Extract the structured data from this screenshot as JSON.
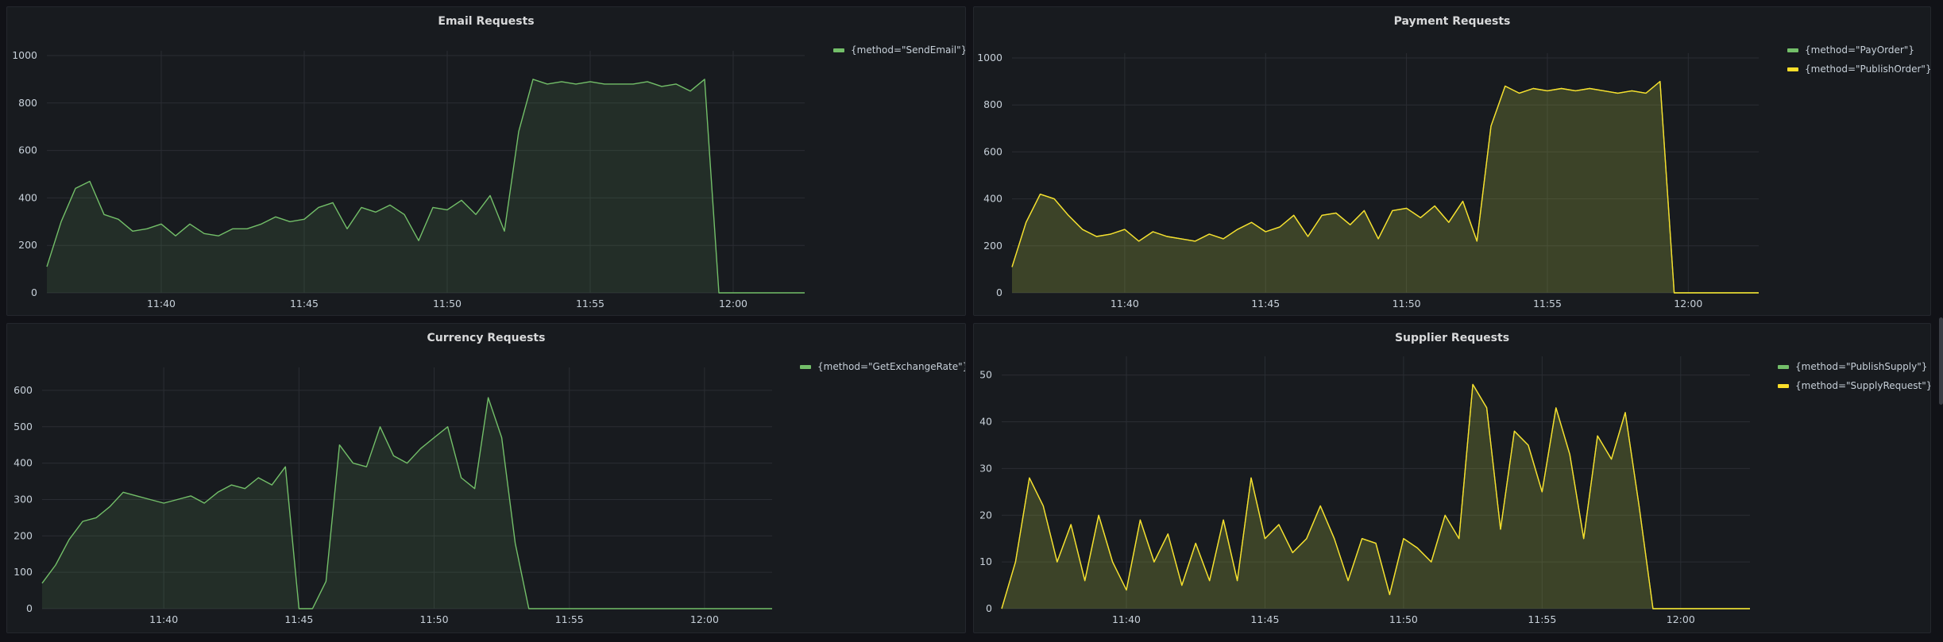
{
  "chart_data": [
    {
      "type": "area",
      "title": "Email Requests",
      "ylim": [
        0,
        1000
      ],
      "yticks": [
        0,
        200,
        400,
        600,
        800,
        1000
      ],
      "xlim": [
        "11:36:00",
        "12:02:30"
      ],
      "xticks": [
        "11:40",
        "11:45",
        "11:50",
        "11:55",
        "12:00"
      ],
      "grid": true,
      "legend_position": "top-right",
      "x": [
        "11:36:00",
        "11:36:30",
        "11:37:00",
        "11:37:30",
        "11:38:00",
        "11:38:30",
        "11:39:00",
        "11:39:30",
        "11:40:00",
        "11:40:30",
        "11:41:00",
        "11:41:30",
        "11:42:00",
        "11:42:30",
        "11:43:00",
        "11:43:30",
        "11:44:00",
        "11:44:30",
        "11:45:00",
        "11:45:30",
        "11:46:00",
        "11:46:30",
        "11:47:00",
        "11:47:30",
        "11:48:00",
        "11:48:30",
        "11:49:00",
        "11:49:30",
        "11:50:00",
        "11:50:30",
        "11:51:00",
        "11:51:30",
        "11:52:00",
        "11:52:30",
        "11:53:00",
        "11:53:30",
        "11:54:00",
        "11:54:30",
        "11:55:00",
        "11:55:30",
        "11:56:00",
        "11:56:30",
        "11:57:00",
        "11:57:30",
        "11:58:00",
        "11:58:30",
        "11:59:00",
        "11:59:30",
        "12:00:00",
        "12:00:30",
        "12:01:00",
        "12:01:30",
        "12:02:00",
        "12:02:30"
      ],
      "series": [
        {
          "name": "{method=\"SendEmail\"}",
          "color": "#73bf69",
          "values": [
            110,
            300,
            440,
            470,
            330,
            310,
            260,
            270,
            290,
            240,
            290,
            250,
            240,
            270,
            270,
            290,
            320,
            300,
            310,
            360,
            380,
            270,
            360,
            340,
            370,
            330,
            220,
            360,
            350,
            390,
            330,
            410,
            260,
            680,
            900,
            880,
            890,
            880,
            890,
            880,
            880,
            880,
            890,
            870,
            880,
            850,
            900,
            0,
            0,
            0,
            0,
            0,
            0,
            0
          ]
        }
      ]
    },
    {
      "type": "area",
      "title": "Payment Requests",
      "ylim": [
        0,
        1000
      ],
      "yticks": [
        0,
        200,
        400,
        600,
        800,
        1000
      ],
      "xlim": [
        "11:36:00",
        "12:02:30"
      ],
      "xticks": [
        "11:40",
        "11:45",
        "11:50",
        "11:55",
        "12:00"
      ],
      "grid": true,
      "legend_position": "top-right",
      "x": [
        "11:36:00",
        "11:36:30",
        "11:37:00",
        "11:37:30",
        "11:38:00",
        "11:38:30",
        "11:39:00",
        "11:39:30",
        "11:40:00",
        "11:40:30",
        "11:41:00",
        "11:41:30",
        "11:42:00",
        "11:42:30",
        "11:43:00",
        "11:43:30",
        "11:44:00",
        "11:44:30",
        "11:45:00",
        "11:45:30",
        "11:46:00",
        "11:46:30",
        "11:47:00",
        "11:47:30",
        "11:48:00",
        "11:48:30",
        "11:49:00",
        "11:49:30",
        "11:50:00",
        "11:50:30",
        "11:51:00",
        "11:51:30",
        "11:52:00",
        "11:52:30",
        "11:53:00",
        "11:53:30",
        "11:54:00",
        "11:54:30",
        "11:55:00",
        "11:55:30",
        "11:56:00",
        "11:56:30",
        "11:57:00",
        "11:57:30",
        "11:58:00",
        "11:58:30",
        "11:59:00",
        "11:59:30",
        "12:00:00",
        "12:00:30",
        "12:01:00",
        "12:01:30",
        "12:02:00",
        "12:02:30"
      ],
      "series": [
        {
          "name": "{method=\"PayOrder\"}",
          "color": "#73bf69",
          "values": [
            110,
            300,
            420,
            400,
            330,
            270,
            240,
            250,
            270,
            220,
            260,
            240,
            230,
            220,
            250,
            230,
            270,
            300,
            260,
            280,
            330,
            240,
            330,
            340,
            290,
            350,
            230,
            350,
            360,
            320,
            370,
            300,
            390,
            220,
            710,
            880,
            850,
            870,
            860,
            870,
            860,
            870,
            860,
            850,
            860,
            850,
            900,
            0,
            0,
            0,
            0,
            0,
            0,
            0
          ]
        },
        {
          "name": "{method=\"PublishOrder\"}",
          "color": "#fade2a",
          "values": [
            110,
            300,
            420,
            400,
            330,
            270,
            240,
            250,
            270,
            220,
            260,
            240,
            230,
            220,
            250,
            230,
            270,
            300,
            260,
            280,
            330,
            240,
            330,
            340,
            290,
            350,
            230,
            350,
            360,
            320,
            370,
            300,
            390,
            220,
            710,
            880,
            850,
            870,
            860,
            870,
            860,
            870,
            860,
            850,
            860,
            850,
            900,
            0,
            0,
            0,
            0,
            0,
            0,
            0
          ]
        }
      ]
    },
    {
      "type": "area",
      "title": "Currency Requests",
      "ylim": [
        0,
        650
      ],
      "yticks": [
        0,
        100,
        200,
        300,
        400,
        500,
        600
      ],
      "xlim": [
        "11:35:30",
        "12:02:30"
      ],
      "xticks": [
        "11:40",
        "11:45",
        "11:50",
        "11:55",
        "12:00"
      ],
      "grid": true,
      "legend_position": "top-right",
      "x": [
        "11:35:30",
        "11:36:00",
        "11:36:30",
        "11:37:00",
        "11:37:30",
        "11:38:00",
        "11:38:30",
        "11:39:00",
        "11:39:30",
        "11:40:00",
        "11:40:30",
        "11:41:00",
        "11:41:30",
        "11:42:00",
        "11:42:30",
        "11:43:00",
        "11:43:30",
        "11:44:00",
        "11:44:30",
        "11:45:00",
        "11:45:30",
        "11:46:00",
        "11:46:30",
        "11:47:00",
        "11:47:30",
        "11:48:00",
        "11:48:30",
        "11:49:00",
        "11:49:30",
        "11:50:00",
        "11:50:30",
        "11:51:00",
        "11:51:30",
        "11:52:00",
        "11:52:30",
        "11:53:00",
        "11:53:30",
        "11:54:00",
        "11:54:30",
        "11:55:00",
        "11:55:30",
        "11:56:00",
        "11:56:30",
        "11:57:00",
        "11:57:30",
        "11:58:00",
        "11:58:30",
        "11:59:00",
        "11:59:30",
        "12:00:00",
        "12:00:30",
        "12:01:00",
        "12:01:30",
        "12:02:00",
        "12:02:30"
      ],
      "series": [
        {
          "name": "{method=\"GetExchangeRate\"}",
          "color": "#73bf69",
          "values": [
            70,
            120,
            190,
            240,
            250,
            280,
            320,
            310,
            300,
            290,
            300,
            310,
            290,
            320,
            340,
            330,
            360,
            340,
            390,
            0,
            0,
            75,
            450,
            400,
            390,
            500,
            420,
            400,
            440,
            470,
            500,
            360,
            330,
            580,
            470,
            180,
            0,
            0,
            0,
            0,
            0,
            0,
            0,
            0,
            0,
            0,
            0,
            0,
            0,
            0,
            0,
            0,
            0,
            0,
            0
          ]
        }
      ]
    },
    {
      "type": "area",
      "title": "Supplier Requests",
      "ylim": [
        0,
        53
      ],
      "yticks": [
        0,
        10,
        20,
        30,
        40,
        50
      ],
      "xlim": [
        "11:35:30",
        "12:02:30"
      ],
      "xticks": [
        "11:40",
        "11:45",
        "11:50",
        "11:55",
        "12:00"
      ],
      "grid": true,
      "legend_position": "top-right",
      "x": [
        "11:35:30",
        "11:36:00",
        "11:36:30",
        "11:37:00",
        "11:37:30",
        "11:38:00",
        "11:38:30",
        "11:39:00",
        "11:39:30",
        "11:40:00",
        "11:40:30",
        "11:41:00",
        "11:41:30",
        "11:42:00",
        "11:42:30",
        "11:43:00",
        "11:43:30",
        "11:44:00",
        "11:44:30",
        "11:45:00",
        "11:45:30",
        "11:46:00",
        "11:46:30",
        "11:47:00",
        "11:47:30",
        "11:48:00",
        "11:48:30",
        "11:49:00",
        "11:49:30",
        "11:50:00",
        "11:50:30",
        "11:51:00",
        "11:51:30",
        "11:52:00",
        "11:52:30",
        "11:53:00",
        "11:53:30",
        "11:54:00",
        "11:54:30",
        "11:55:00",
        "11:55:30",
        "11:56:00",
        "11:56:30",
        "11:57:00",
        "11:57:30",
        "11:58:00",
        "11:58:30",
        "11:59:00",
        "11:59:30",
        "12:00:00",
        "12:00:30",
        "12:01:00",
        "12:01:30",
        "12:02:00",
        "12:02:30"
      ],
      "series": [
        {
          "name": "{method=\"PublishSupply\"}",
          "color": "#73bf69",
          "values": [
            0,
            10,
            28,
            22,
            10,
            18,
            6,
            20,
            10,
            4,
            19,
            10,
            16,
            5,
            14,
            6,
            19,
            6,
            28,
            15,
            18,
            12,
            15,
            22,
            15,
            6,
            15,
            14,
            3,
            15,
            13,
            10,
            20,
            15,
            48,
            43,
            17,
            38,
            35,
            25,
            43,
            33,
            15,
            37,
            32,
            42,
            22,
            0,
            0,
            0,
            0,
            0,
            0,
            0,
            0
          ]
        },
        {
          "name": "{method=\"SupplyRequest\"}",
          "color": "#fade2a",
          "values": [
            0,
            10,
            28,
            22,
            10,
            18,
            6,
            20,
            10,
            4,
            19,
            10,
            16,
            5,
            14,
            6,
            19,
            6,
            28,
            15,
            18,
            12,
            15,
            22,
            15,
            6,
            15,
            14,
            3,
            15,
            13,
            10,
            20,
            15,
            48,
            43,
            17,
            38,
            35,
            25,
            43,
            33,
            15,
            37,
            32,
            42,
            22,
            0,
            0,
            0,
            0,
            0,
            0,
            0,
            0
          ]
        }
      ]
    }
  ]
}
